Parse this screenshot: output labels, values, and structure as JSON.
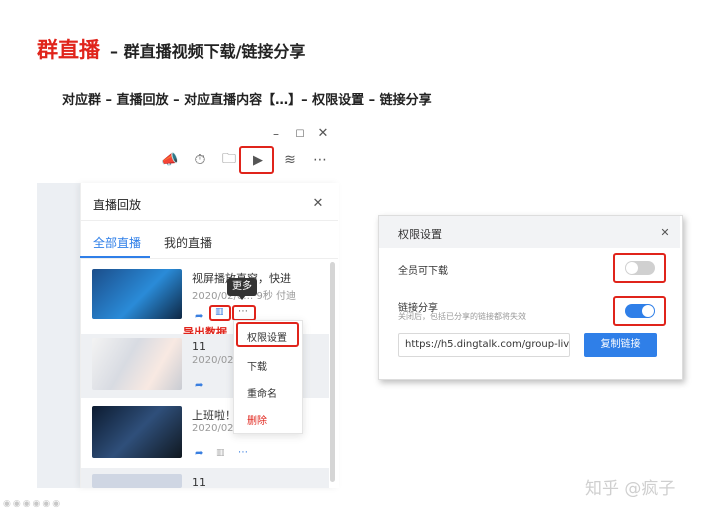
{
  "header": {
    "title_red": "群直播",
    "title_black": "– 群直播视频下载/链接分享",
    "subtitle": "对应群 – 直播回放 – 对应直播内容【…】– 权限设置 – 链接分享"
  },
  "main_window": {
    "panel_title": "直播回放",
    "tabs": [
      "全部直播",
      "我的直播"
    ],
    "videos": [
      {
        "title": "视屏播放直窗，快进",
        "meta": "2020/02/0… 9秒 付迪"
      },
      {
        "title": "11",
        "meta": "2020/02/0…"
      },
      {
        "title": "上班啦！",
        "meta": "2020/02/0…"
      },
      {
        "title": "11",
        "meta": ""
      }
    ],
    "tooltip": "更多",
    "export_label": "导出数据",
    "menu": [
      "权限设置",
      "下载",
      "重命名",
      "删除"
    ]
  },
  "perm_dialog": {
    "title": "权限设置",
    "all_download_label": "全员可下载",
    "link_share_label": "链接分享",
    "link_share_desc": "关闭后，包括已分享的链接都将失效",
    "link_value": "https://h5.dingtalk.com/group-liv…",
    "copy_button": "复制链接",
    "all_download_on": false,
    "link_share_on": true
  },
  "watermark": "知乎 @疯子",
  "colors": {
    "accent": "#e0241b",
    "blue": "#3a7fe0",
    "toggle_on": "#2f7fe8",
    "toggle_off": "#d0d0d0"
  }
}
